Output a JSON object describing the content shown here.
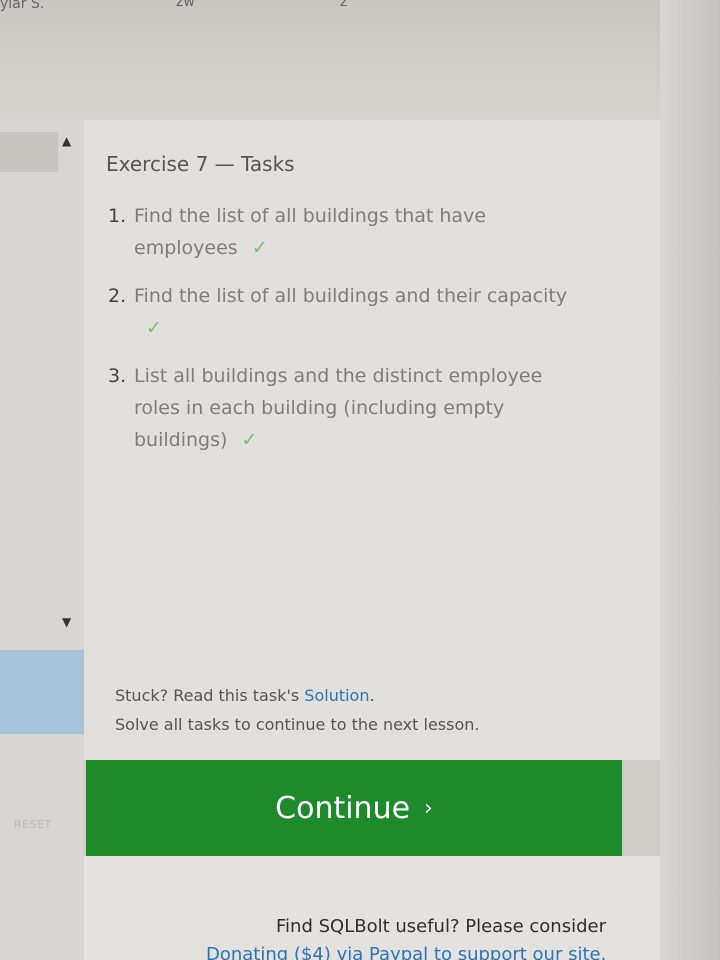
{
  "top": {
    "fragment_left": "ylar S.",
    "fragment_mid": "zw",
    "fragment_right": "z"
  },
  "left": {
    "scroll_up_icon": "triangle-up",
    "scroll_down_icon": "triangle-down",
    "reset_label": "RESET"
  },
  "exercise": {
    "title": "Exercise 7 — Tasks",
    "tasks": [
      {
        "number": "1.",
        "line1": "Find the list of all buildings that have",
        "line2": "employees",
        "done": true
      },
      {
        "number": "2.",
        "line1": "Find the list of all buildings and their capacity",
        "line2": "",
        "done": true
      },
      {
        "number": "3.",
        "line1": "List all buildings and the distinct employee",
        "line2": "roles in each building (including empty",
        "line3": "buildings)",
        "done": true
      }
    ],
    "check_mark": "✓"
  },
  "footer": {
    "stuck_prefix": "Stuck? Read this task's",
    "solution_link": "Solution",
    "stuck_suffix": ".",
    "solve_text": "Solve all tasks to continue to the next lesson.",
    "continue_label": "Continue",
    "continue_chevron": "›"
  },
  "promo": {
    "line1": "Find SQLBolt useful? Please consider",
    "line2": "Donating ($4) via Paypal to support our site."
  },
  "colors": {
    "button": "#1e8a2c",
    "link": "#2f72b8",
    "check": "#7bbf6a"
  }
}
